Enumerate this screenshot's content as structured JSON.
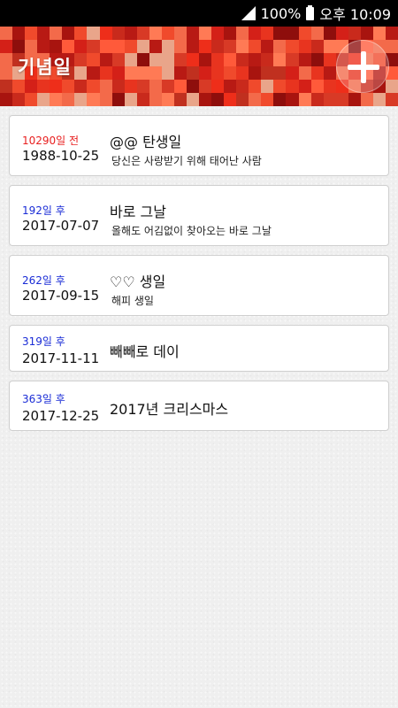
{
  "status_bar": {
    "battery_percent": "100%",
    "time": "오후 10:09"
  },
  "header": {
    "title": "기념일",
    "add_icon": "plus-icon"
  },
  "anniversaries": [
    {
      "dday": "10290일 전",
      "dday_color": "#e82020",
      "date": "1988-10-25",
      "name": "@@ 탄생일",
      "memo": "당신은 사랑받기 위해 태어난 사람"
    },
    {
      "dday": "192일 후",
      "dday_color": "#1a2cd6",
      "date": "2017-07-07",
      "name": "바로 그날",
      "memo": "올해도 어김없이 찾아오는 바로 그날"
    },
    {
      "dday": "262일 후",
      "dday_color": "#1a2cd6",
      "date": "2017-09-15",
      "name": "♡♡ 생일",
      "memo": "해피 생일"
    },
    {
      "dday": "319일 후",
      "dday_color": "#1a2cd6",
      "date": "2017-11-11",
      "name": "빼빼로 데이",
      "memo": ""
    },
    {
      "dday": "363일 후",
      "dday_color": "#1a2cd6",
      "date": "2017-12-25",
      "name": "2017년 크리스마스",
      "memo": ""
    }
  ]
}
